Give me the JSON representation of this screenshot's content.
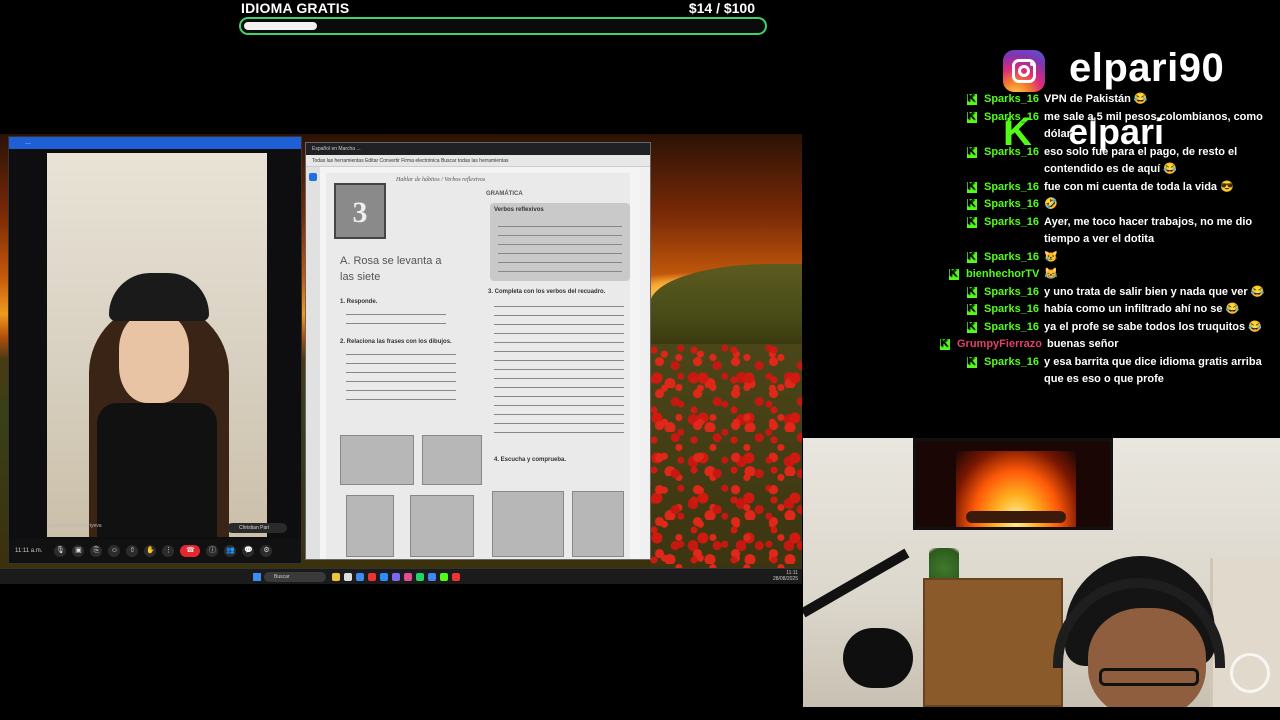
{
  "goal": {
    "title": "IDIOMA GRATIS",
    "amount": "$14  / $100",
    "progress": 0.14
  },
  "call": {
    "title_bar": "...",
    "caller_name": "assem.zhamanseriyeva",
    "self_name": "Christian Pari",
    "clock": "11:11 a.m."
  },
  "book": {
    "tabs": "Español en Marcha ...",
    "toolbar": "Todas las herramientas  Editar  Convertir  Firma electrónica  Buscar todas las herramientas",
    "unit_number": "3",
    "subtitle": "Hablar de hábitos / Verbos reflexivos",
    "lesson_title": "A. Rosa se levanta a las siete",
    "grammar_heading": "GRAMÁTICA",
    "table_title": "Verbos reflexivos",
    "q1": "1. Responde.",
    "q2": "2. Relaciona las frases con los dibujos.",
    "q3": "3. Completa con los verbos del recuadro.",
    "q4": "4. Escucha y comprueba."
  },
  "taskbar": {
    "search": "Buscar",
    "time": "11:11",
    "date": "28/08/2025",
    "weather": "17°C"
  },
  "social": {
    "instagram": "elpari90",
    "kick": "elpari"
  },
  "chat": [
    {
      "user": "Sparks_16",
      "text": "VPN de Pakistán 😂",
      "user_color": "#53fc18"
    },
    {
      "user": "Sparks_16",
      "text": "me sale a 5 mil pesos colombianos, como dólar",
      "user_color": "#53fc18"
    },
    {
      "user": "Sparks_16",
      "text": "eso solo fue para el pago, de resto el contendido es de aquí 😂",
      "user_color": "#53fc18"
    },
    {
      "user": "Sparks_16",
      "text": "fue con mi cuenta de toda la vida 😎",
      "user_color": "#53fc18"
    },
    {
      "user": "Sparks_16",
      "text": "🤣",
      "user_color": "#53fc18"
    },
    {
      "user": "Sparks_16",
      "text": "Ayer, me toco hacer trabajos, no me dio tiempo a ver el dotita",
      "user_color": "#53fc18"
    },
    {
      "user": "Sparks_16",
      "text": "😿",
      "user_color": "#53fc18"
    },
    {
      "user": "bienhechorTV",
      "text": "😹",
      "user_color": "#53fc18"
    },
    {
      "user": "Sparks_16",
      "text": "y uno trata de salir bien y nada que ver 😂",
      "user_color": "#53fc18"
    },
    {
      "user": "Sparks_16",
      "text": "había como un infiltrado ahí no se 😂",
      "user_color": "#53fc18"
    },
    {
      "user": "Sparks_16",
      "text": "ya el profe se sabe todos los truquitos 😂",
      "user_color": "#53fc18"
    },
    {
      "user": "GrumpyFierrazo",
      "text": "buenas señor",
      "user_color": "#e0406a"
    },
    {
      "user": "Sparks_16",
      "text": "y esa barrita que dice idioma gratis arriba que es eso o que profe",
      "user_color": "#53fc18"
    }
  ],
  "colors": {
    "goal_border": "#3fd36b",
    "kick_green": "#53fc18"
  }
}
